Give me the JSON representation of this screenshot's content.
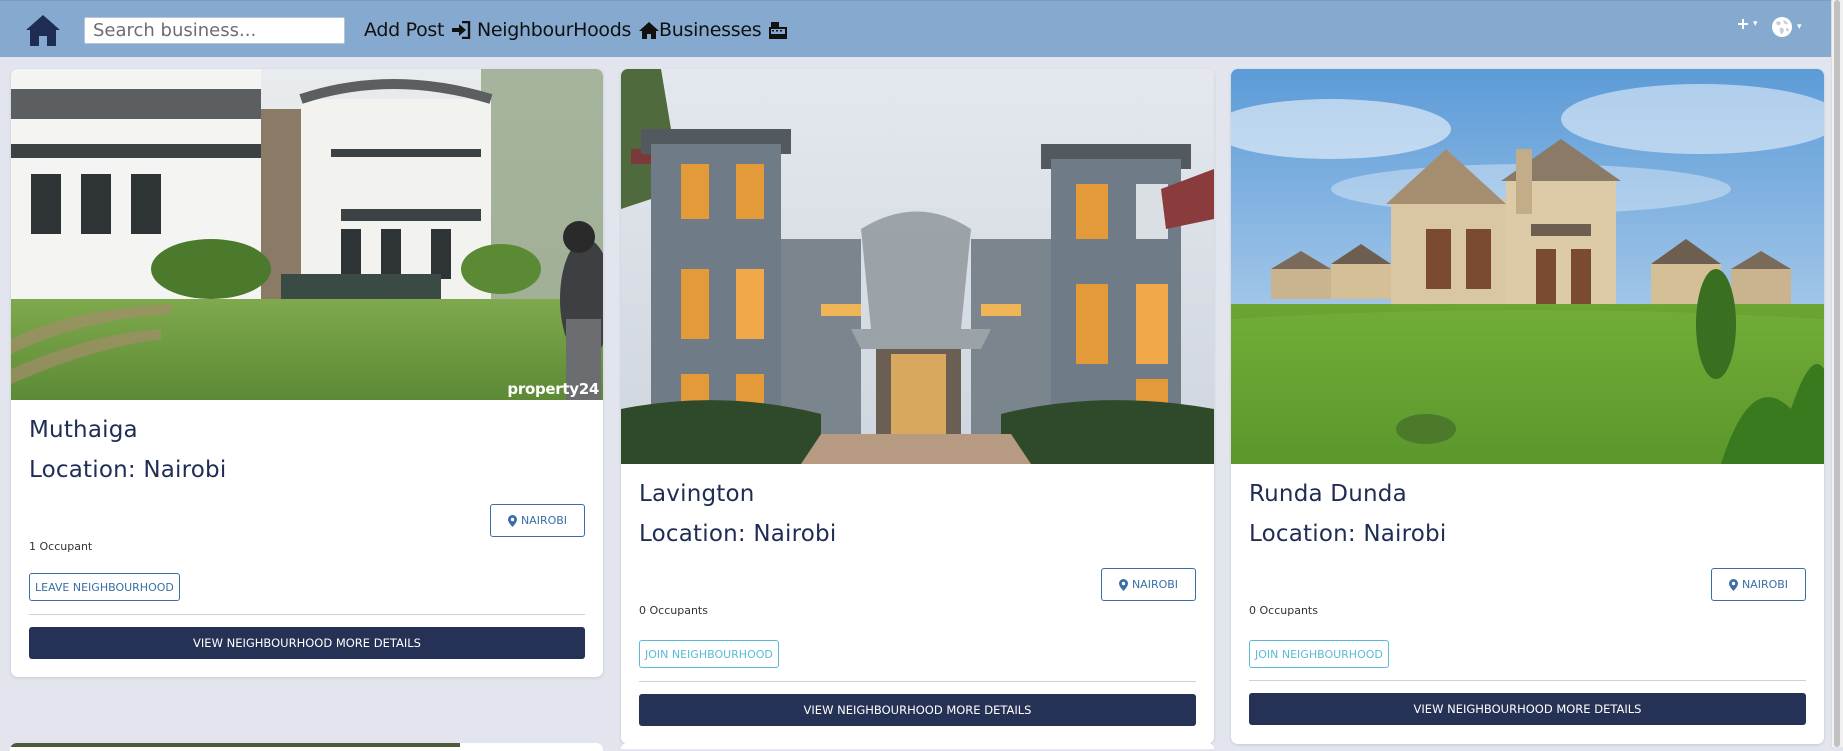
{
  "search": {
    "placeholder": "Search business..."
  },
  "nav": {
    "add_post": "Add Post",
    "neighbourhoods": "NeighbourHoods",
    "businesses": "Businesses"
  },
  "icons": {
    "home": "home-icon",
    "add_post": "sign-in-icon",
    "neighbourhoods": "home-icon",
    "businesses": "cash-register-icon",
    "plus": "plus-icon",
    "language": "globe-icon",
    "location": "map-marker-icon"
  },
  "colors": {
    "navbar": "#86a9d0",
    "page_background": "#e2e5ee",
    "primary_dark": "#253255",
    "outline_blue": "#3a6ea5",
    "outline_info": "#5bbad4"
  },
  "cards": [
    {
      "name": "Muthaiga",
      "location": "Location: Nairobi",
      "badge": "NAIROBI",
      "occupants": "1 Occupant",
      "action": "LEAVE NEIGHBOURHOOD",
      "details": "VIEW NEIGHBOURHOOD MORE DETAILS",
      "watermark": "property24"
    },
    {
      "name": "Lavington",
      "location": "Location: Nairobi",
      "badge": "NAIROBI",
      "occupants": "0 Occupants",
      "action": "JOIN NEIGHBOURHOOD",
      "details": "VIEW NEIGHBOURHOOD MORE DETAILS"
    },
    {
      "name": "Runda Dunda",
      "location": "Location: Nairobi",
      "badge": "NAIROBI",
      "occupants": "0 Occupants",
      "action": "JOIN NEIGHBOURHOOD",
      "details": "VIEW NEIGHBOURHOOD MORE DETAILS"
    }
  ]
}
